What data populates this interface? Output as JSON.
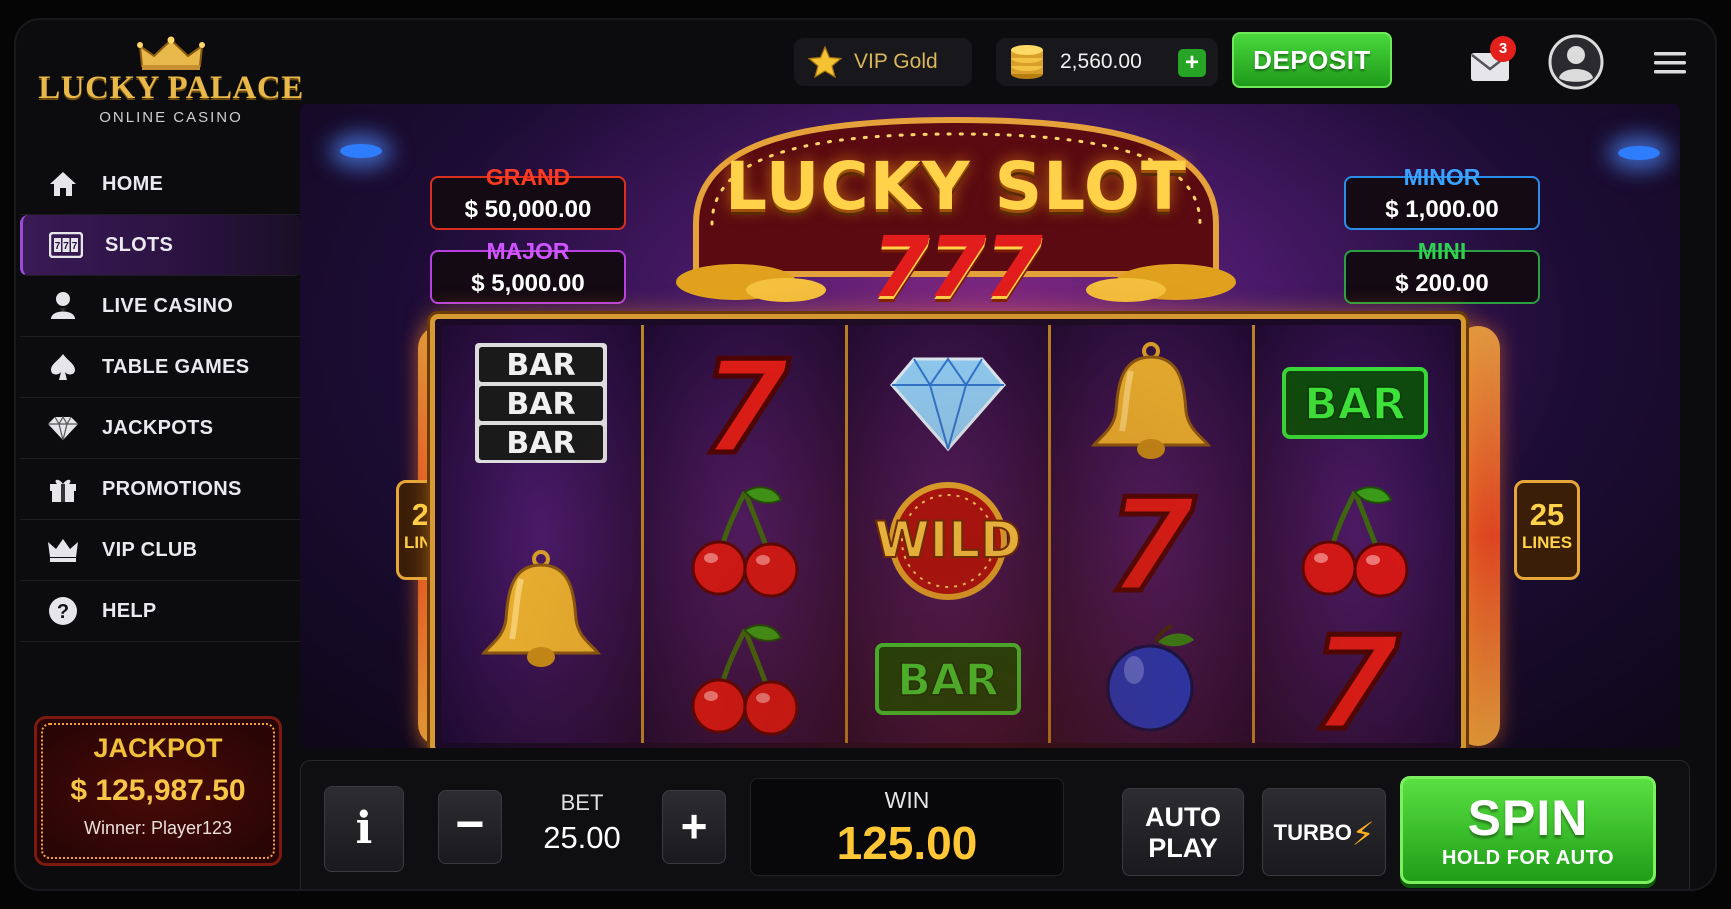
{
  "logo": {
    "title": "LUCKY PALACE",
    "subtitle": "ONLINE CASINO"
  },
  "nav": [
    {
      "label": "HOME",
      "icon": "home-icon"
    },
    {
      "label": "SLOTS",
      "icon": "slot-machine-icon",
      "active": true
    },
    {
      "label": "LIVE CASINO",
      "icon": "dealer-icon"
    },
    {
      "label": "TABLE GAMES",
      "icon": "spade-icon"
    },
    {
      "label": "JACKPOTS",
      "icon": "diamond-icon"
    },
    {
      "label": "PROMOTIONS",
      "icon": "gift-icon"
    },
    {
      "label": "VIP CLUB",
      "icon": "crown-icon"
    },
    {
      "label": "HELP",
      "icon": "help-icon"
    }
  ],
  "sidebar_jackpot": {
    "title": "JACKPOT",
    "amount": "$ 125,987.50",
    "winner": "Winner: Player123"
  },
  "topbar": {
    "vip_label": "VIP Gold",
    "balance": "2,560.00",
    "add_label": "+",
    "deposit_label": "DEPOSIT",
    "mail_count": "3"
  },
  "game": {
    "title_line1": "LUCKY SLOT",
    "title_line2": "777",
    "info_label": "i",
    "jackpots": {
      "grand": {
        "label": "GRAND",
        "value": "$ 50,000.00"
      },
      "major": {
        "label": "MAJOR",
        "value": "$ 5,000.00"
      },
      "minor": {
        "label": "MINOR",
        "value": "$ 1,000.00"
      },
      "mini": {
        "label": "MINI",
        "value": "$ 200.00"
      }
    },
    "lines": {
      "count": "25",
      "label": "LINES"
    },
    "reels": [
      [
        "triple-bar",
        "bell",
        "empty"
      ],
      [
        "seven",
        "cherries",
        "cherries"
      ],
      [
        "diamond",
        "wild",
        "bar"
      ],
      [
        "bell",
        "seven",
        "plum"
      ],
      [
        "bar",
        "cherries",
        "seven"
      ]
    ],
    "symbol_text": {
      "bar": "BAR",
      "wild": "WILD",
      "seven": "7"
    }
  },
  "controls": {
    "info_label": "i",
    "minus_label": "−",
    "plus_label": "+",
    "bet_label": "BET",
    "bet_value": "25.00",
    "win_label": "WIN",
    "win_value": "125.00",
    "auto_line1": "AUTO",
    "auto_line2": "PLAY",
    "turbo_label": "TURBO",
    "turbo_symbol": "⚡",
    "spin_label": "SPIN",
    "spin_sub": "HOLD FOR AUTO"
  },
  "colors": {
    "accent_green": "#27a325",
    "gold": "#ffc736",
    "nav_active": "#3a1a55"
  }
}
